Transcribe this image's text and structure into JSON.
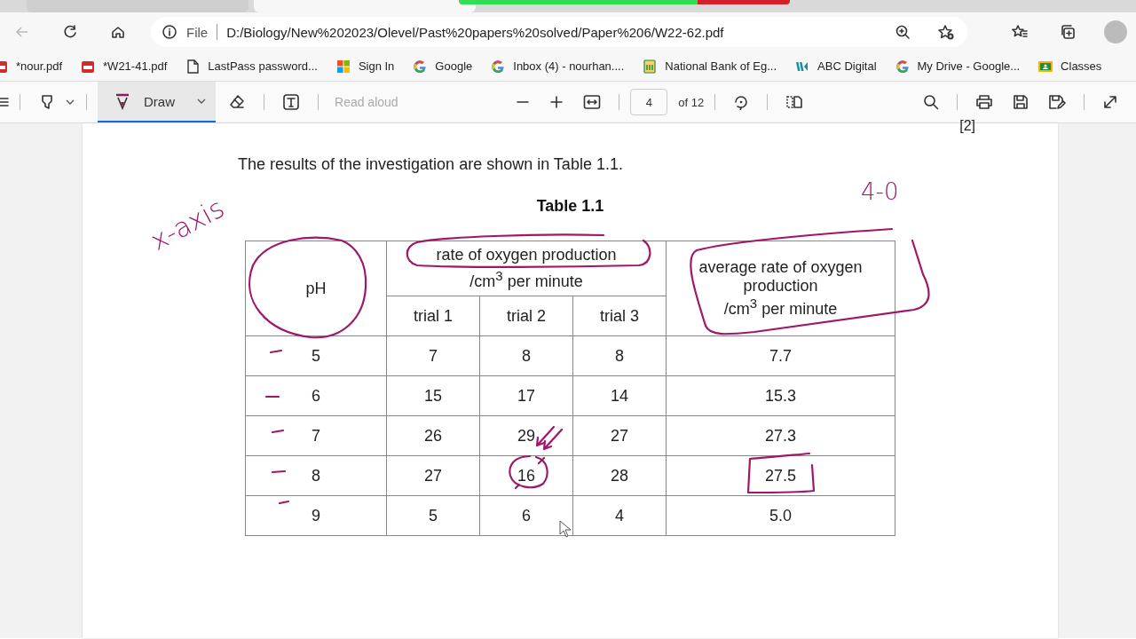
{
  "tabs": [
    {
      "selected": false
    },
    {
      "selected": true
    }
  ],
  "address_bar": {
    "scheme_label": "File",
    "url": "D:/Biology/New%202023/Olevel/Past%20papers%20solved/Paper%206/W22-62.pdf"
  },
  "bookmarks": [
    {
      "label": "*nour.pdf",
      "kind": "pdf"
    },
    {
      "label": "*W21-41.pdf",
      "kind": "pdf"
    },
    {
      "label": "LastPass password...",
      "kind": "page"
    },
    {
      "label": "Sign In",
      "kind": "windows"
    },
    {
      "label": "Google",
      "kind": "google"
    },
    {
      "label": "Inbox (4) - nourhan....",
      "kind": "google"
    },
    {
      "label": "National Bank of Eg...",
      "kind": "bank"
    },
    {
      "label": "ABC Digital",
      "kind": "abc"
    },
    {
      "label": "My Drive - Google...",
      "kind": "google"
    },
    {
      "label": "Classes",
      "kind": "classroom"
    }
  ],
  "pdf_toolbar": {
    "draw_label": "Draw",
    "draw_selected": true,
    "read_aloud": {
      "label": "Read aloud",
      "disabled": true
    },
    "page": "4",
    "page_count": "of 12"
  },
  "document": {
    "page_mark": "[2]",
    "intro": "The results of the investigation are shown in Table 1.1.",
    "table_title": "Table 1.1",
    "table": {
      "first_header": "pH",
      "group_header": [
        "rate of oxygen production",
        "/cm$^{3}$ per minute"
      ],
      "sub_headers": [
        "trial 1",
        "trial 2",
        "trial 3"
      ],
      "last_header": [
        "average rate of oxygen",
        "production",
        "/cm$^{3}$ per minute"
      ],
      "rows": [
        [
          "5",
          "7",
          "8",
          "8",
          "7.7"
        ],
        [
          "6",
          "15",
          "17",
          "14",
          "15.3"
        ],
        [
          "7",
          "26",
          "29",
          "27",
          "27.3"
        ],
        [
          "8",
          "27",
          "16",
          "28",
          "27.5"
        ],
        [
          "9",
          "5",
          "6",
          "4",
          "5.0"
        ]
      ]
    }
  },
  "annotations": [
    {
      "text": "x-axis",
      "kind": "axis-note"
    },
    {
      "text": "4-0",
      "kind": "corner-note"
    }
  ]
}
